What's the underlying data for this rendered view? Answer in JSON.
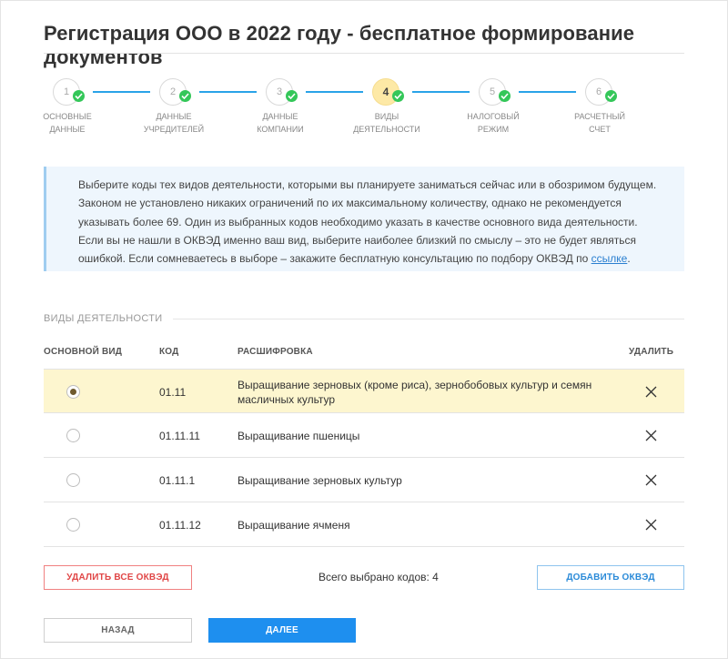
{
  "page": {
    "title": "Регистрация ООО в 2022 году - бесплатное формирование документов"
  },
  "stepper": {
    "steps": [
      {
        "number": "1",
        "label": "ОСНОВНЫЕ\nДАННЫЕ",
        "state": "done"
      },
      {
        "number": "2",
        "label": "ДАННЫЕ\nУЧРЕДИТЕЛЕЙ",
        "state": "done"
      },
      {
        "number": "3",
        "label": "ДАННЫЕ\nКОМПАНИИ",
        "state": "done"
      },
      {
        "number": "4",
        "label": "ВИДЫ\nДЕЯТЕЛЬНОСТИ",
        "state": "current"
      },
      {
        "number": "5",
        "label": "НАЛОГОВЫЙ\nРЕЖИМ",
        "state": "done"
      },
      {
        "number": "6",
        "label": "РАСЧЕТНЫЙ\nСЧЕТ",
        "state": "done"
      }
    ],
    "line_color": "#2aa3e8",
    "check_color": "#34c759"
  },
  "info": {
    "text": "Выберите коды тех видов деятельности, которыми вы планируете заниматься сейчас или в обозримом будущем. Законом не установлено никаких ограничений по их максимальному количеству, однако не рекомендуется указывать более 69. Один из выбранных кодов необходимо указать в качестве основного вида деятельности. Если вы не нашли в ОКВЭД именно ваш вид, выберите наиболее близкий по смыслу – это не будет являться ошибкой. Если сомневаетесь в выборе – закажите бесплатную консультацию по подбору ОКВЭД по",
    "link_text": "ссылке",
    "after_link": "."
  },
  "section": {
    "title": "ВИДЫ ДЕЯТЕЛЬНОСТИ"
  },
  "table": {
    "headers": {
      "main": "ОСНОВНОЙ ВИД",
      "code": "КОД",
      "desc": "РАСШИФРОВКА",
      "remove": "УДАЛИТЬ"
    },
    "rows": [
      {
        "code": "01.11",
        "desc": "Выращивание зерновых (кроме риса), зернобобовых культур и семян масличных культур",
        "primary": true
      },
      {
        "code": "01.11.11",
        "desc": "Выращивание пшеницы",
        "primary": false
      },
      {
        "code": "01.11.1",
        "desc": "Выращивание зерновых культур",
        "primary": false
      },
      {
        "code": "01.11.12",
        "desc": "Выращивание ячменя",
        "primary": false
      }
    ]
  },
  "actions": {
    "delete_all": "УДАЛИТЬ ВСЕ ОКВЭД",
    "total": "Всего выбрано кодов: 4",
    "add": "ДОБАВИТЬ ОКВЭД",
    "back": "НАЗАД",
    "next": "ДАЛЕЕ"
  },
  "colors": {
    "primary_button": "#1e8fef",
    "selected_row": "#fdf6cf",
    "danger": "#e04646"
  }
}
